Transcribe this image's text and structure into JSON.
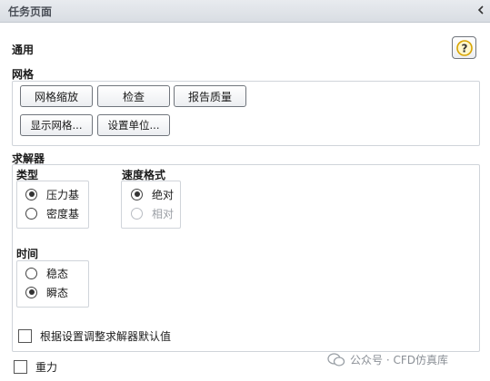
{
  "panel": {
    "title": "任务页面"
  },
  "general": {
    "heading": "通用",
    "help_glyph": "?"
  },
  "mesh": {
    "heading": "网格",
    "buttons": {
      "scale": "网格缩放",
      "check": "检查",
      "report_quality": "报告质量",
      "display_mesh": "显示网格...",
      "set_units": "设置单位..."
    }
  },
  "solver": {
    "heading": "求解器",
    "type": {
      "label": "类型",
      "options": [
        "压力基",
        "密度基"
      ],
      "selected": "压力基"
    },
    "velocity_formulation": {
      "label": "速度格式",
      "options": [
        "绝对",
        "相对"
      ],
      "selected": "绝对",
      "disabled": [
        "相对"
      ]
    },
    "time": {
      "label": "时间",
      "options": [
        "稳态",
        "瞬态"
      ],
      "selected": "瞬态"
    },
    "adjust_defaults": {
      "label": "根据设置调整求解器默认值",
      "checked": false
    }
  },
  "gravity": {
    "label": "重力",
    "checked": false
  },
  "watermark": {
    "text": "公众号 · CFD仿真库"
  },
  "colors": {
    "titlebar": "#dde1e6",
    "border": "#d0d4da",
    "help_icon": "#d8a400"
  }
}
